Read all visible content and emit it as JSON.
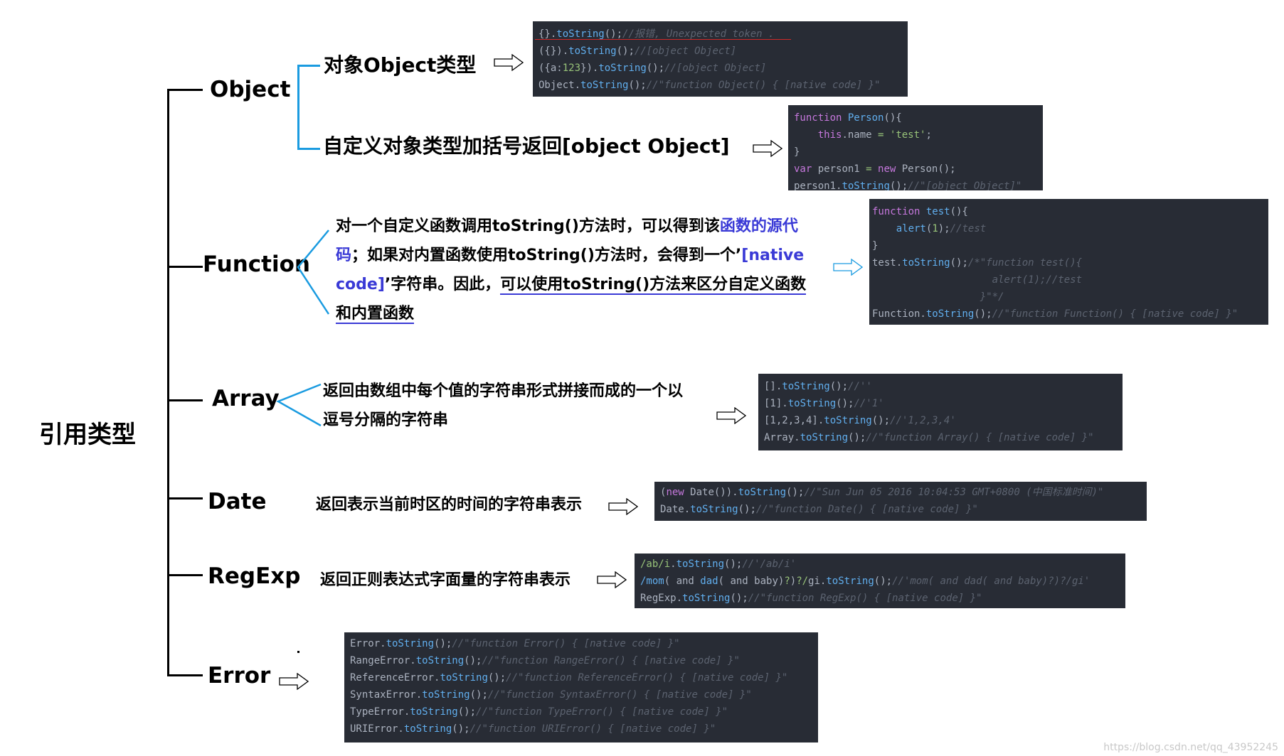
{
  "root": "引用类型",
  "branches": {
    "object": "Object",
    "function": "Function",
    "array": "Array",
    "date": "Date",
    "regexp": "RegExp",
    "error": "Error"
  },
  "object": {
    "sub1": "对象Object类型",
    "sub2": "自定义对象类型加括号返回[object Object]",
    "code1": [
      [
        [
          "p",
          "{}."
        ],
        [
          "b",
          "toString"
        ],
        [
          "p",
          "();"
        ],
        [
          "c",
          "//报错, Unexpected token ."
        ]
      ],
      [
        [
          "p",
          "({})."
        ],
        [
          "b",
          "toString"
        ],
        [
          "p",
          "();"
        ],
        [
          "c",
          "//[object Object]"
        ]
      ],
      [
        [
          "p",
          "({a:"
        ],
        [
          "g",
          "123"
        ],
        [
          "p",
          "})."
        ],
        [
          "b",
          "toString"
        ],
        [
          "p",
          "();"
        ],
        [
          "c",
          "//[object Object]"
        ]
      ],
      [
        [
          "p",
          "Object."
        ],
        [
          "b",
          "toString"
        ],
        [
          "p",
          "();"
        ],
        [
          "c",
          "//\"function Object() { [native code] }\""
        ]
      ]
    ],
    "code2": [
      [
        [
          "k",
          "function "
        ],
        [
          "b",
          "Person"
        ],
        [
          "p",
          "(){"
        ]
      ],
      [
        [
          "p",
          "    "
        ],
        [
          "k",
          "this"
        ],
        [
          "p",
          ".name "
        ],
        [
          "g",
          "="
        ],
        [
          "p",
          " "
        ],
        [
          "g",
          "'test'"
        ],
        [
          "p",
          ";"
        ]
      ],
      [
        [
          "p",
          "}"
        ]
      ],
      [
        [
          "k",
          "var"
        ],
        [
          "p",
          " person1 "
        ],
        [
          "g",
          "="
        ],
        [
          "p",
          " "
        ],
        [
          "k",
          "new"
        ],
        [
          "p",
          " Person();"
        ]
      ],
      [
        [
          "p",
          "person1."
        ],
        [
          "b",
          "toString"
        ],
        [
          "p",
          "();"
        ],
        [
          "c",
          "//\"[object Object]\""
        ]
      ]
    ]
  },
  "function": {
    "desc": [
      [
        [
          "n",
          "对一个自定义函数调用toString()方法时，可以得到该"
        ],
        [
          "h",
          "函数的源代"
        ]
      ],
      [
        [
          "h",
          "码"
        ],
        [
          "n",
          "；如果对内置函数使用toString()方法时，会得到一个’"
        ],
        [
          "h",
          "[native"
        ]
      ],
      [
        [
          "h",
          "code]"
        ],
        [
          "n",
          "’字符串。因此，"
        ],
        [
          "u",
          "可以使用toString()方法来区分自定义函数"
        ]
      ],
      [
        [
          "u",
          "和内置函数"
        ]
      ]
    ],
    "code": [
      [
        [
          "k",
          "function "
        ],
        [
          "b",
          "test"
        ],
        [
          "p",
          "(){"
        ]
      ],
      [
        [
          "p",
          "    "
        ],
        [
          "b",
          "alert"
        ],
        [
          "p",
          "("
        ],
        [
          "g",
          "1"
        ],
        [
          "p",
          ");"
        ],
        [
          "c",
          "//test"
        ]
      ],
      [
        [
          "p",
          "}"
        ]
      ],
      [
        [
          "p",
          "test."
        ],
        [
          "b",
          "toString"
        ],
        [
          "p",
          "();"
        ],
        [
          "c",
          "/*\"function test(){"
        ]
      ],
      [
        [
          "c",
          "                    alert(1);//test"
        ]
      ],
      [
        [
          "c",
          "                  }\"*/"
        ]
      ],
      [
        [
          "p",
          "Function."
        ],
        [
          "b",
          "toString"
        ],
        [
          "p",
          "();"
        ],
        [
          "c",
          "//\"function Function() { [native code] }\""
        ]
      ]
    ]
  },
  "array": {
    "desc": [
      "返回由数组中每个值的字符串形式拼接而成的一个以",
      "逗号分隔的字符串"
    ],
    "code": [
      [
        [
          "p",
          "[]."
        ],
        [
          "b",
          "toString"
        ],
        [
          "p",
          "();"
        ],
        [
          "c",
          "//''"
        ]
      ],
      [
        [
          "p",
          "[1]."
        ],
        [
          "b",
          "toString"
        ],
        [
          "p",
          "();"
        ],
        [
          "c",
          "//'1'"
        ]
      ],
      [
        [
          "p",
          "[1,2,3,4]."
        ],
        [
          "b",
          "toString"
        ],
        [
          "p",
          "();"
        ],
        [
          "c",
          "//'1,2,3,4'"
        ]
      ],
      [
        [
          "p",
          "Array."
        ],
        [
          "b",
          "toString"
        ],
        [
          "p",
          "();"
        ],
        [
          "c",
          "//\"function Array() { [native code] }\""
        ]
      ]
    ]
  },
  "date": {
    "desc": "返回表示当前时区的时间的字符串表示",
    "code": [
      [
        [
          "p",
          "("
        ],
        [
          "k",
          "new"
        ],
        [
          "p",
          " Date())."
        ],
        [
          "b",
          "toString"
        ],
        [
          "p",
          "();"
        ],
        [
          "c",
          "//\"Sun Jun 05 2016 10:04:53 GMT+0800 (中国标准时间)\""
        ]
      ],
      [
        [
          "p",
          "Date."
        ],
        [
          "b",
          "toString"
        ],
        [
          "p",
          "();"
        ],
        [
          "c",
          "//\"function Date() { [native code] }\""
        ]
      ]
    ]
  },
  "regexp": {
    "desc": "返回正则表达式字面量的字符串表示",
    "code": [
      [
        [
          "g",
          "/ab/i"
        ],
        [
          "p",
          "."
        ],
        [
          "b",
          "toString"
        ],
        [
          "p",
          "();"
        ],
        [
          "c",
          "//'/ab/i'"
        ]
      ],
      [
        [
          "b",
          "/mom"
        ],
        [
          "p",
          "( and "
        ],
        [
          "b",
          "dad"
        ],
        [
          "p",
          "( and baby)"
        ],
        [
          "g",
          "?"
        ],
        [
          "p",
          ")"
        ],
        [
          "g",
          "?/"
        ],
        [
          "p",
          "gi."
        ],
        [
          "b",
          "toString"
        ],
        [
          "p",
          "();"
        ],
        [
          "c",
          "//'mom( and dad( and baby)?)?/gi'"
        ]
      ],
      [
        [
          "p",
          "RegExp."
        ],
        [
          "b",
          "toString"
        ],
        [
          "p",
          "();"
        ],
        [
          "c",
          "//\"function RegExp() { [native code] }\""
        ]
      ]
    ]
  },
  "error": {
    "code": [
      [
        [
          "p",
          "Error."
        ],
        [
          "b",
          "toString"
        ],
        [
          "p",
          "();"
        ],
        [
          "c",
          "//\"function Error() { [native code] }\""
        ]
      ],
      [
        [
          "p",
          "RangeError."
        ],
        [
          "b",
          "toString"
        ],
        [
          "p",
          "();"
        ],
        [
          "c",
          "//\"function RangeError() { [native code] }\""
        ]
      ],
      [
        [
          "p",
          "ReferenceError."
        ],
        [
          "b",
          "toString"
        ],
        [
          "p",
          "();"
        ],
        [
          "c",
          "//\"function ReferenceError() { [native code] }\""
        ]
      ],
      [
        [
          "p",
          "SyntaxError."
        ],
        [
          "b",
          "toString"
        ],
        [
          "p",
          "();"
        ],
        [
          "c",
          "//\"function SyntaxError() { [native code] }\""
        ]
      ],
      [
        [
          "p",
          "TypeError."
        ],
        [
          "b",
          "toString"
        ],
        [
          "p",
          "();"
        ],
        [
          "c",
          "//\"function TypeError() { [native code] }\""
        ]
      ],
      [
        [
          "p",
          "URIError."
        ],
        [
          "b",
          "toString"
        ],
        [
          "p",
          "();"
        ],
        [
          "c",
          "//\"function URIError() { [native code] }\""
        ]
      ]
    ]
  },
  "watermark": "https://blog.csdn.net/qq_43952245",
  "colors": {
    "code_bg": "#282c35",
    "keyword": "#c678dd",
    "method": "#61afef",
    "string": "#98c379",
    "comment": "#5c6370",
    "highlight": "#3a3ad6",
    "bracket": "#1a9be0"
  }
}
